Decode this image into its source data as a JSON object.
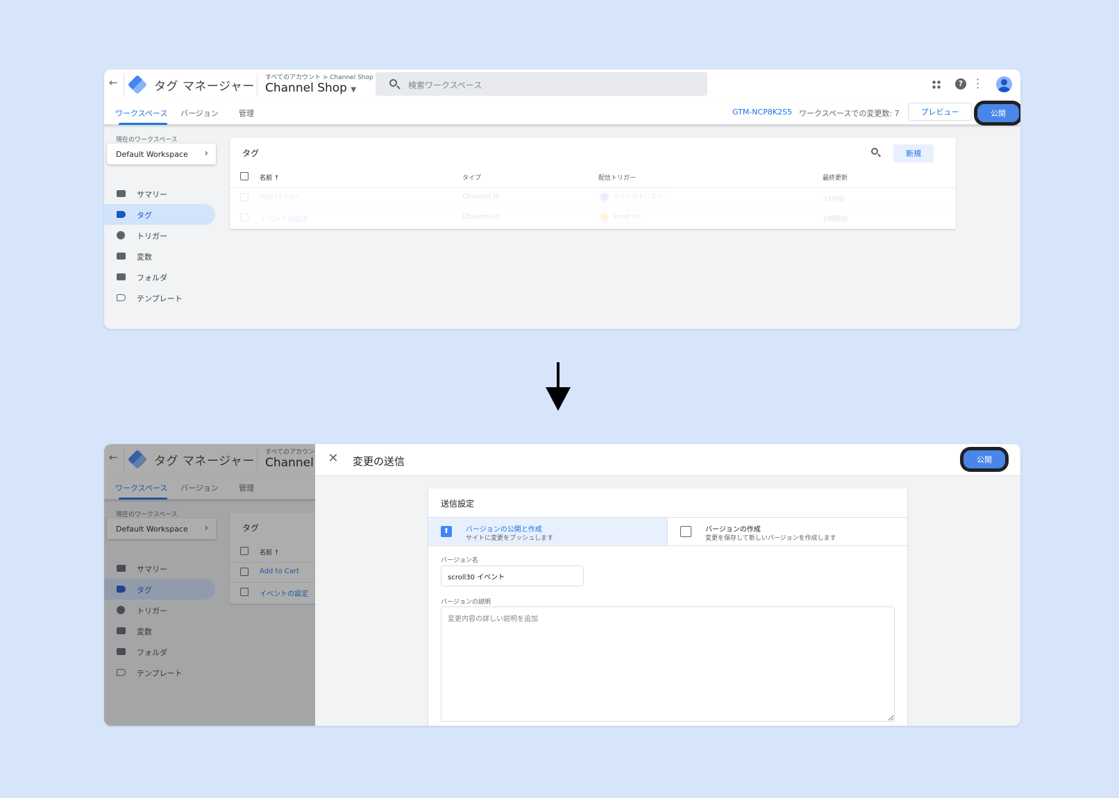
{
  "app": {
    "title": "タグ マネージャー",
    "breadcrumb": "すべてのアカウント > Channel Shop",
    "container": "Channel Shop",
    "search_placeholder": "検索ワークスペース"
  },
  "tabs": [
    "ワークスペース",
    "バージョン",
    "管理"
  ],
  "toolbar": {
    "gtm_id": "GTM-NCP8K2S5",
    "changes": "ワークスペースでの変更数: 7",
    "preview": "プレビュー",
    "publish": "公開"
  },
  "sidebar": {
    "current_label": "現在のワークスペース",
    "workspace": "Default Workspace",
    "items": [
      {
        "label": "サマリー",
        "icon": "briefcase-icon"
      },
      {
        "label": "タグ",
        "icon": "tag-icon",
        "active": true
      },
      {
        "label": "トリガー",
        "icon": "trigger-icon"
      },
      {
        "label": "変数",
        "icon": "variables-icon"
      },
      {
        "label": "フォルダ",
        "icon": "folder-icon"
      },
      {
        "label": "テンプレート",
        "icon": "template-icon"
      }
    ]
  },
  "tags_card": {
    "title": "タグ",
    "new_button": "新規",
    "columns": [
      "名前",
      "タイプ",
      "配信トリガー",
      "最終更新"
    ],
    "sort_indicator": "↑",
    "rows": [
      {
        "name": "Add to Cart",
        "type": "Channel.io",
        "trigger": "クリックトリガー",
        "updated": "33分前"
      },
      {
        "name": "イベントの設定",
        "type": "Channel.io",
        "trigger": "Scroll 30",
        "updated": "1時間前"
      }
    ]
  },
  "submit_panel": {
    "title": "変更の送信",
    "publish": "公開",
    "section_title": "送信設定",
    "options": [
      {
        "title": "バージョンの公開と作成",
        "subtitle": "サイトに変更をプッシュします"
      },
      {
        "title": "バージョンの作成",
        "subtitle": "変更を保存して新しいバージョンを作成します"
      }
    ],
    "version_name_label": "バージョン名",
    "version_name_value": "scroll30 イベント",
    "description_label": "バージョンの説明",
    "description_placeholder": "変更内容の詳しい説明を追加"
  },
  "colors": {
    "accent": "#1a73e8",
    "publish_button": "#4a86e8",
    "background": "#d7e5fb"
  }
}
